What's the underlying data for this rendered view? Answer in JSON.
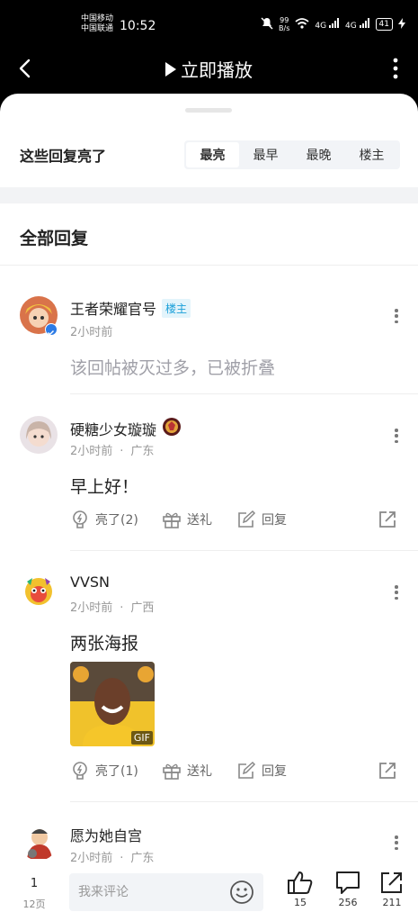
{
  "status_bar": {
    "carrier_1": "中国移动",
    "carrier_2": "中国联通",
    "time": "10:52",
    "net_speed_value": "99",
    "net_speed_unit": "B/s",
    "signal_1": "4G",
    "signal_2": "4G",
    "battery": "41"
  },
  "nav": {
    "title": "立即播放"
  },
  "highlights": {
    "label": "这些回复亮了",
    "tabs": [
      "最亮",
      "最早",
      "最晚",
      "楼主"
    ],
    "active_tab": "最亮"
  },
  "section": {
    "title": "全部回复"
  },
  "comments": [
    {
      "username": "王者荣耀官号",
      "badge": "楼主",
      "time": "2小时前",
      "location": "",
      "text": "该回帖被灭过多，已被折叠"
    },
    {
      "username": "硬糖少女璇璇",
      "time": "2小时前",
      "location": "广东",
      "text": "早上好！",
      "like_label": "亮了(2)",
      "gift_label": "送礼",
      "reply_label": "回复"
    },
    {
      "username": "VVSN",
      "time": "2小时前",
      "location": "广西",
      "text": "两张海报",
      "gif_tag": "GIF",
      "like_label": "亮了(1)",
      "gift_label": "送礼",
      "reply_label": "回复"
    },
    {
      "username": "愿为她自宫",
      "time": "2小时前",
      "location": "广东"
    }
  ],
  "separator": "·",
  "bottom_bar": {
    "page_current": "1",
    "page_total": "12页",
    "input_placeholder": "我来评论",
    "likes": "15",
    "comments": "256",
    "shares": "211"
  },
  "colors": {
    "host_badge": "#1a9fd9",
    "muted_text": "#999999",
    "sort_tab_bg": "#f2f4f7"
  }
}
